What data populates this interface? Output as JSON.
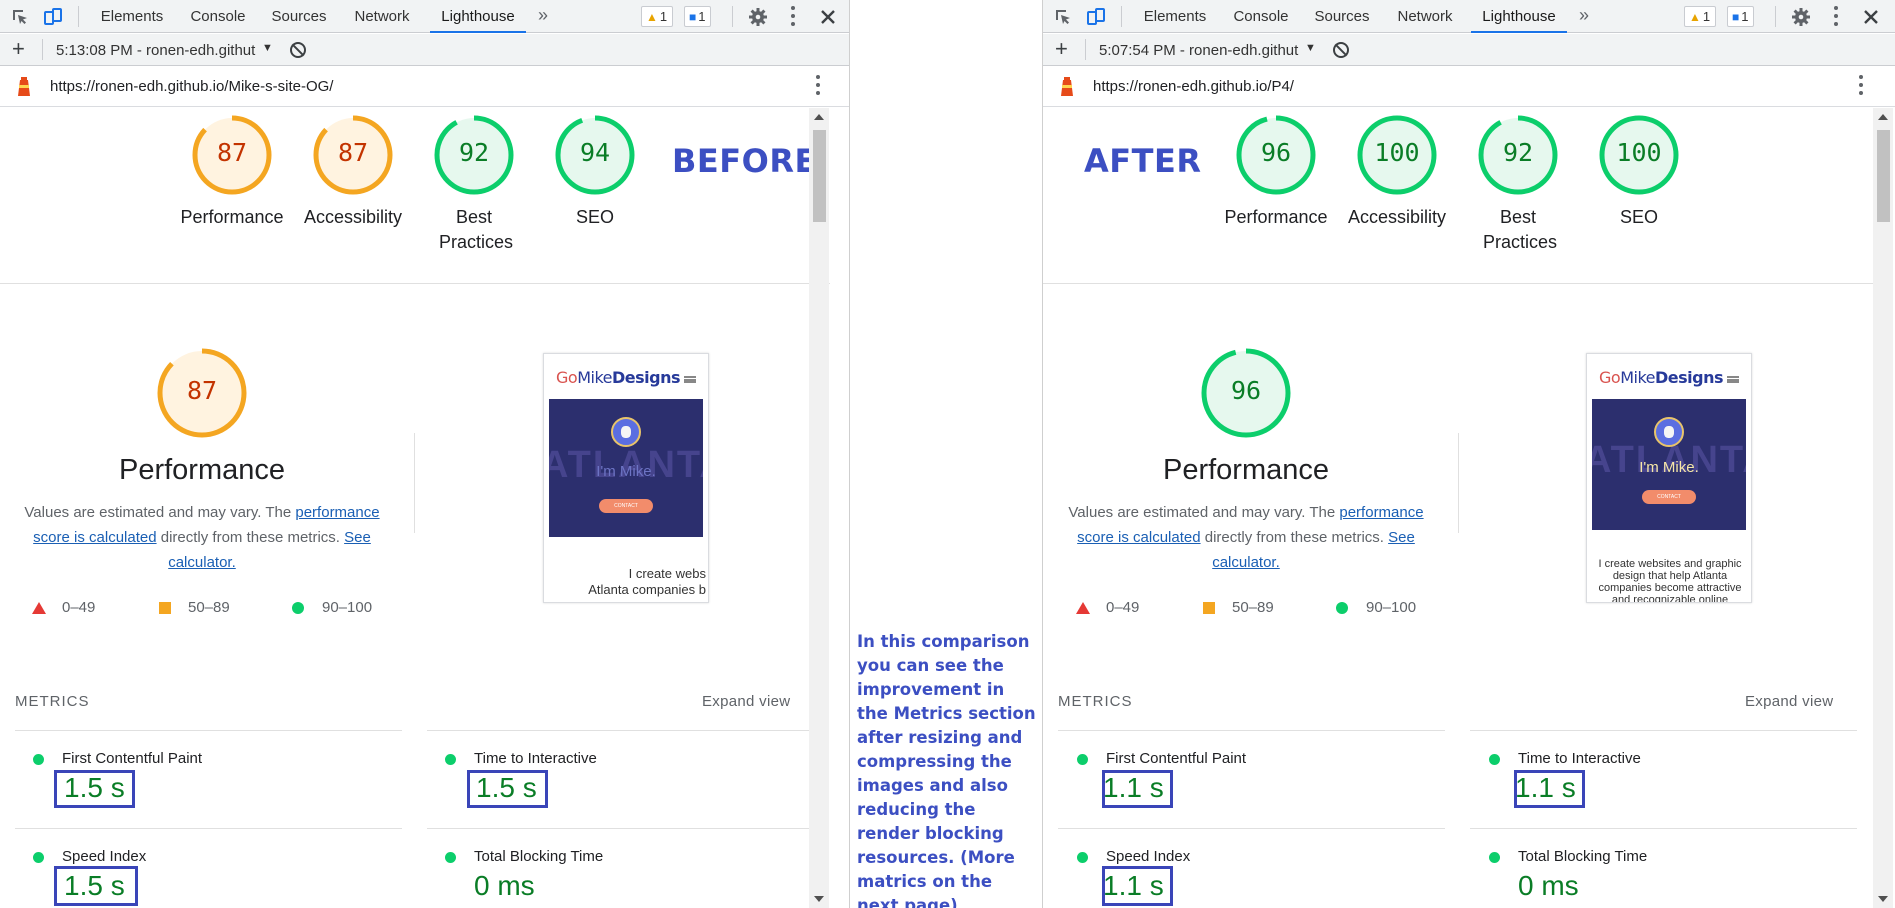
{
  "devtools": {
    "tabs": [
      "Elements",
      "Console",
      "Sources",
      "Network",
      "Lighthouse"
    ],
    "active_tab": "Lighthouse",
    "more_tabs": "»",
    "warnings_count": "1",
    "messages_count": "1"
  },
  "left": {
    "report_time": "5:13:08 PM - ronen-edh.githut",
    "url": "https://ronen-edh.github.io/Mike-s-site-OG/",
    "tag": "BEFORE",
    "gauges": [
      {
        "score": "87",
        "label": "Performance",
        "level": "average"
      },
      {
        "score": "87",
        "label": "Accessibility",
        "level": "average"
      },
      {
        "score": "92",
        "label": "Best Practices",
        "level": "pass"
      },
      {
        "score": "94",
        "label": "SEO",
        "level": "pass"
      }
    ],
    "perf_score": "87",
    "perf_title": "Performance",
    "preview": {
      "logo_a": "Go",
      "logo_b": "Mike",
      "logo_c": "Designs",
      "bg_text": "ATLANTA",
      "hello": "I'm Mike.",
      "button": "CONTACT",
      "body": "I create webs\nAtlanta companies b"
    },
    "metrics": [
      {
        "title": "First Contentful Paint",
        "value": "1.5 s"
      },
      {
        "title": "Time to Interactive",
        "value": "1.5 s"
      },
      {
        "title": "Speed Index",
        "value": "1.5 s"
      },
      {
        "title": "Total Blocking Time",
        "value": "0 ms"
      }
    ]
  },
  "right": {
    "report_time": "5:07:54 PM - ronen-edh.githut",
    "url": "https://ronen-edh.github.io/P4/",
    "tag": "AFTER",
    "gauges": [
      {
        "score": "96",
        "label": "Performance",
        "level": "pass"
      },
      {
        "score": "100",
        "label": "Accessibility",
        "level": "pass"
      },
      {
        "score": "92",
        "label": "Best Practices",
        "level": "pass"
      },
      {
        "score": "100",
        "label": "SEO",
        "level": "pass"
      }
    ],
    "perf_score": "96",
    "perf_title": "Performance",
    "preview": {
      "logo_a": "Go",
      "logo_b": "Mike",
      "logo_c": "Designs",
      "bg_text": "ATLANTA",
      "hello": "I'm Mike.",
      "button": "CONTACT",
      "body": "I create websites and graphic design that help Atlanta companies become attractive and recognizable online"
    },
    "metrics": [
      {
        "title": "First Contentful Paint",
        "value": "1.1 s"
      },
      {
        "title": "Time to Interactive",
        "value": "1.1 s"
      },
      {
        "title": "Speed Index",
        "value": "1.1 s"
      },
      {
        "title": "Total Blocking Time",
        "value": "0 ms"
      }
    ]
  },
  "perf_desc": {
    "pre": "Values are estimated and may vary. The ",
    "link1": "performance score is calculated",
    "mid": " directly from these metrics. ",
    "link2": "See calculator."
  },
  "legend": {
    "fail": "0–49",
    "average": "50–89",
    "pass": "90–100"
  },
  "metrics_heading": "METRICS",
  "expand_view": "Expand view",
  "annotation": "In this comparison you can see the improvement in the Metrics section after resizing and compressing the images and also reducing the render blocking resources. (More matrics on the next page)",
  "colors": {
    "average": "#f4a621",
    "average_fill": "#fff3e0",
    "pass": "#0cce6b",
    "pass_fill": "#e6f8ee",
    "fail": "#e53935",
    "highlight_box": "#3a45b8",
    "annotation_text": "#3c4fc2",
    "devtools_active_underline": "#1a73e8"
  }
}
